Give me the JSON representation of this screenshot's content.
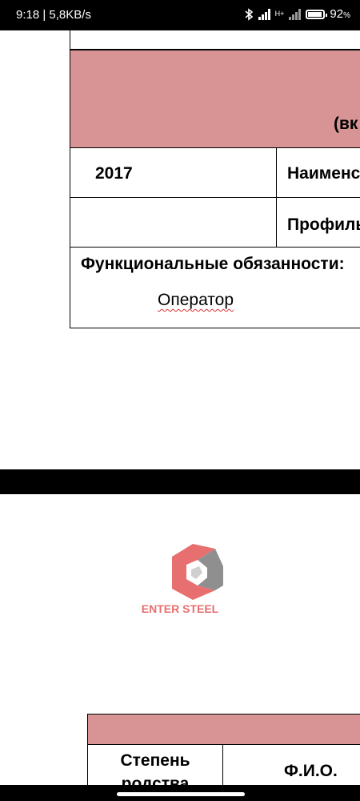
{
  "status_bar": {
    "time": "9:18 | 5,8KB/s",
    "network": "H+",
    "battery": "92",
    "battery_level": 0.92
  },
  "page1": {
    "header_partial": "(вк",
    "year": "2017",
    "name_label_partial": "Наименс",
    "profile_label_partial": "Профиль",
    "duties_label": "Функциональные обязанности:",
    "duties_value": "Оператор"
  },
  "page2": {
    "logo_text": "ENTER STEEL",
    "col_kinship": "Степень родства",
    "col_fio": "Ф.И.О."
  },
  "colors": {
    "header_fill": "#d89494",
    "logo_red": "#e86f6f",
    "logo_grey": "#8f8f8f"
  }
}
